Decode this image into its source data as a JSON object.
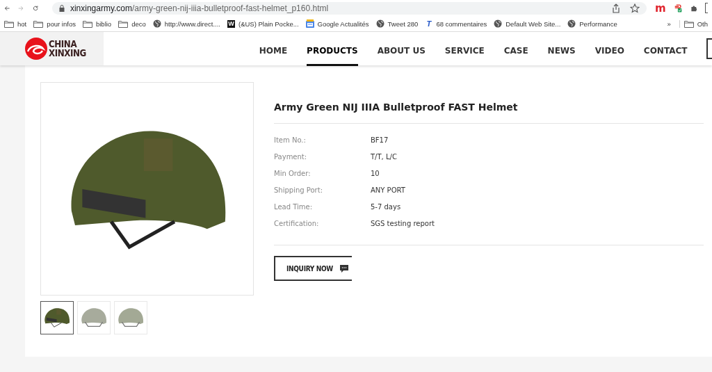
{
  "browser": {
    "url_domain": "xinxingarmy.com",
    "url_path": "/army-green-nij-iiia-bulletproof-fast-helmet_p160.html",
    "extension_label": "m"
  },
  "bookmarks": [
    {
      "kind": "folder",
      "label": "hot"
    },
    {
      "kind": "folder",
      "label": "pour infos"
    },
    {
      "kind": "folder",
      "label": "biblio"
    },
    {
      "kind": "folder",
      "label": "deco"
    },
    {
      "kind": "globe",
      "label": "http://www.direct...."
    },
    {
      "kind": "letter",
      "icon_text": "W",
      "label": "(&US) Plain Pocke..."
    },
    {
      "kind": "news",
      "label": "Google Actualités"
    },
    {
      "kind": "globe",
      "label": "Tweet 280"
    },
    {
      "kind": "tletter",
      "icon_text": "T",
      "label": "68 commentaires"
    },
    {
      "kind": "globe",
      "label": "Default Web Site..."
    },
    {
      "kind": "globe",
      "label": "Performance"
    }
  ],
  "bookmarks_more": "»",
  "other_bookmarks": "Oth",
  "site": {
    "logo_top": "CHINA",
    "logo_bottom": "XINXING",
    "nav": [
      {
        "label": "HOME",
        "selected": false
      },
      {
        "label": "PRODUCTS",
        "selected": true
      },
      {
        "label": "ABOUT US",
        "selected": false
      },
      {
        "label": "SERVICE",
        "selected": false
      },
      {
        "label": "CASE",
        "selected": false
      },
      {
        "label": "NEWS",
        "selected": false
      },
      {
        "label": "VIDEO",
        "selected": false
      },
      {
        "label": "CONTACT",
        "selected": false
      }
    ]
  },
  "product": {
    "title": "Army Green NIJ IIIA Bulletproof FAST Helmet",
    "specs": [
      {
        "label": "Item No.:",
        "value": "BF17"
      },
      {
        "label": "Payment:",
        "value": "T/T, L/C"
      },
      {
        "label": "Min Order:",
        "value": "10"
      },
      {
        "label": "Shipping Port:",
        "value": "ANY PORT"
      },
      {
        "label": "Lead Time:",
        "value": "5-7 days"
      },
      {
        "label": "Certification:",
        "value": "SGS testing report"
      }
    ],
    "inquiry_button": "INQUIRY NOW",
    "thumbnails": [
      {
        "selected": true
      },
      {
        "selected": false
      },
      {
        "selected": false
      }
    ]
  }
}
